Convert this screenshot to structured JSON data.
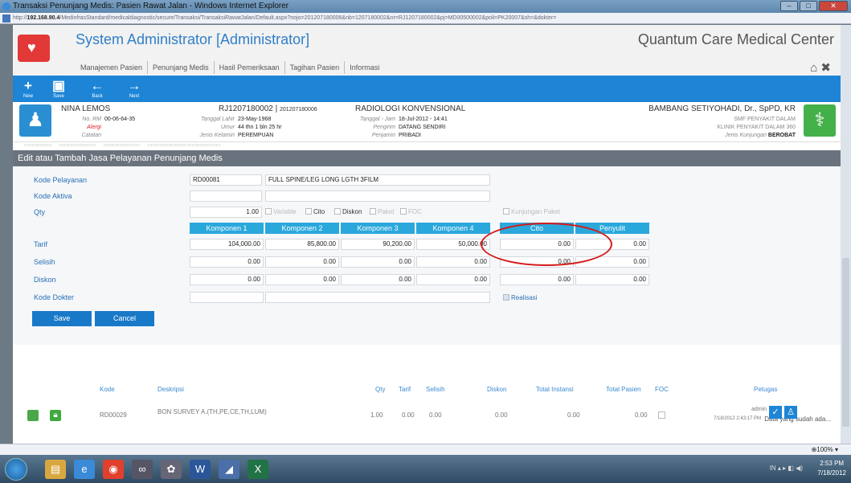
{
  "window": {
    "title": "Transaksi Penunjang Medis: Pasien Rawat Jalan - Windows Internet Explorer",
    "url_prefix": "http://",
    "url_host": "192.168.90.4",
    "url_rest": "/MedinfrasStandard/medicaldiagnostic/secure/Transaksi/TransaksiRawatJalan/Default.aspx?nojo=201207180006&nb=1207180002&nr=RJ1207180002&pj=MD00500002&poli=PK20007&sh=&dokter="
  },
  "app": {
    "title": "System Administrator [Administrator]",
    "hospital": "Quantum Care Medical Center",
    "menu": [
      "Manajemen Pasien",
      "Penunjang Medis",
      "Hasil Pemeriksaan",
      "Tagihan Pasien",
      "Informasi"
    ]
  },
  "toolbar": {
    "new": "New",
    "save": "Save",
    "back": "Back",
    "next": "Next"
  },
  "patient": {
    "name": "NINA LEMOS",
    "rm_label": "No. RM",
    "rm": "00-06-64-35",
    "alergi_label": "Alergi",
    "catatan_label": "Catatan",
    "reg_no": "RJ1207180002",
    "reg_sep": "|",
    "reg_sub": "201207180006",
    "dob_label": "Tanggal Lahir",
    "dob": "23-May-1968",
    "age_label": "Umur",
    "age": "44 thn 1 bln 25 hr",
    "sex_label": "Jenis Kelamin",
    "sex": "PEREMPUAN",
    "unit": "RADIOLOGI KONVENSIONAL",
    "date_label": "Tanggal - Jam",
    "date": "18-Jul-2012 - 14:41",
    "sender_label": "Pengirim",
    "sender": "DATANG SENDIRI",
    "payer_label": "Penjamin",
    "payer": "PRIBADI",
    "doctor": "BAMBANG SETIYOHADI, Dr., SpPD, KR",
    "smf": "SMF PENYAKIT DALAM",
    "clinic": "KLINIK PENYAKIT DALAM 360",
    "visit_label": "Jenis Kunjungan",
    "visit": "BEROBAT"
  },
  "form": {
    "header": "Edit atau Tambah Jasa Pelayanan Penunjang Medis",
    "kode_pelayanan_label": "Kode Pelayanan",
    "kode_pelayanan": "RD00081",
    "deskripsi": "FULL SPINE/LEG LONG LGTH 3FILM",
    "kode_aktiva_label": "Kode Aktiva",
    "qty_label": "Qty",
    "qty": "1.00",
    "checks": {
      "variable": "Variable",
      "cito": "Cito",
      "diskon": "Diskon",
      "paket": "Paket",
      "foc": "FOC",
      "kunjungan_paket": "Kunjungan Paket"
    },
    "col_headers": [
      "Komponen 1",
      "Komponen 2",
      "Komponen 3",
      "Komponen 4",
      "Cito",
      "Penyulit"
    ],
    "rows": [
      {
        "label": "Tarif",
        "values": [
          "104,000.00",
          "85,800.00",
          "90,200.00",
          "50,000.00",
          "0.00",
          "0.00"
        ]
      },
      {
        "label": "Selisih",
        "values": [
          "0.00",
          "0.00",
          "0.00",
          "0.00",
          "0.00",
          "0.00"
        ]
      },
      {
        "label": "Diskon",
        "values": [
          "0.00",
          "0.00",
          "0.00",
          "0.00",
          "0.00",
          "0.00"
        ]
      }
    ],
    "kode_dokter_label": "Kode Dokter",
    "realisasi": "Realisasi",
    "save": "Save",
    "cancel": "Cancel"
  },
  "list": {
    "caption": "Data yang sudah ada...",
    "headers": {
      "kode": "Kode",
      "deskripsi": "Deskripsi",
      "qty": "Qty",
      "tarif": "Tarif",
      "selisih": "Selisih",
      "diskon": "Diskon",
      "total_instansi": "Total Instansi",
      "total_pasien": "Total Pasien",
      "foc": "FOC",
      "petugas": "Petugas"
    },
    "row": {
      "kode": "RD00029",
      "deskripsi": "BON SURVEY A.(TH,PE,CE,TH,LUM)",
      "qty": "1.00",
      "tarif": "0.00",
      "selisih": "0.00",
      "diskon": "0.00",
      "total_instansi": "0.00",
      "total_pasien": "0.00",
      "petugas": "admin",
      "petugas_time": "7/18/2012 2:43:17 PM"
    }
  },
  "statusbar": {
    "zoom": "100%"
  },
  "taskbar": {
    "time": "2:53 PM",
    "date": "7/18/2012",
    "lang": "IN"
  }
}
